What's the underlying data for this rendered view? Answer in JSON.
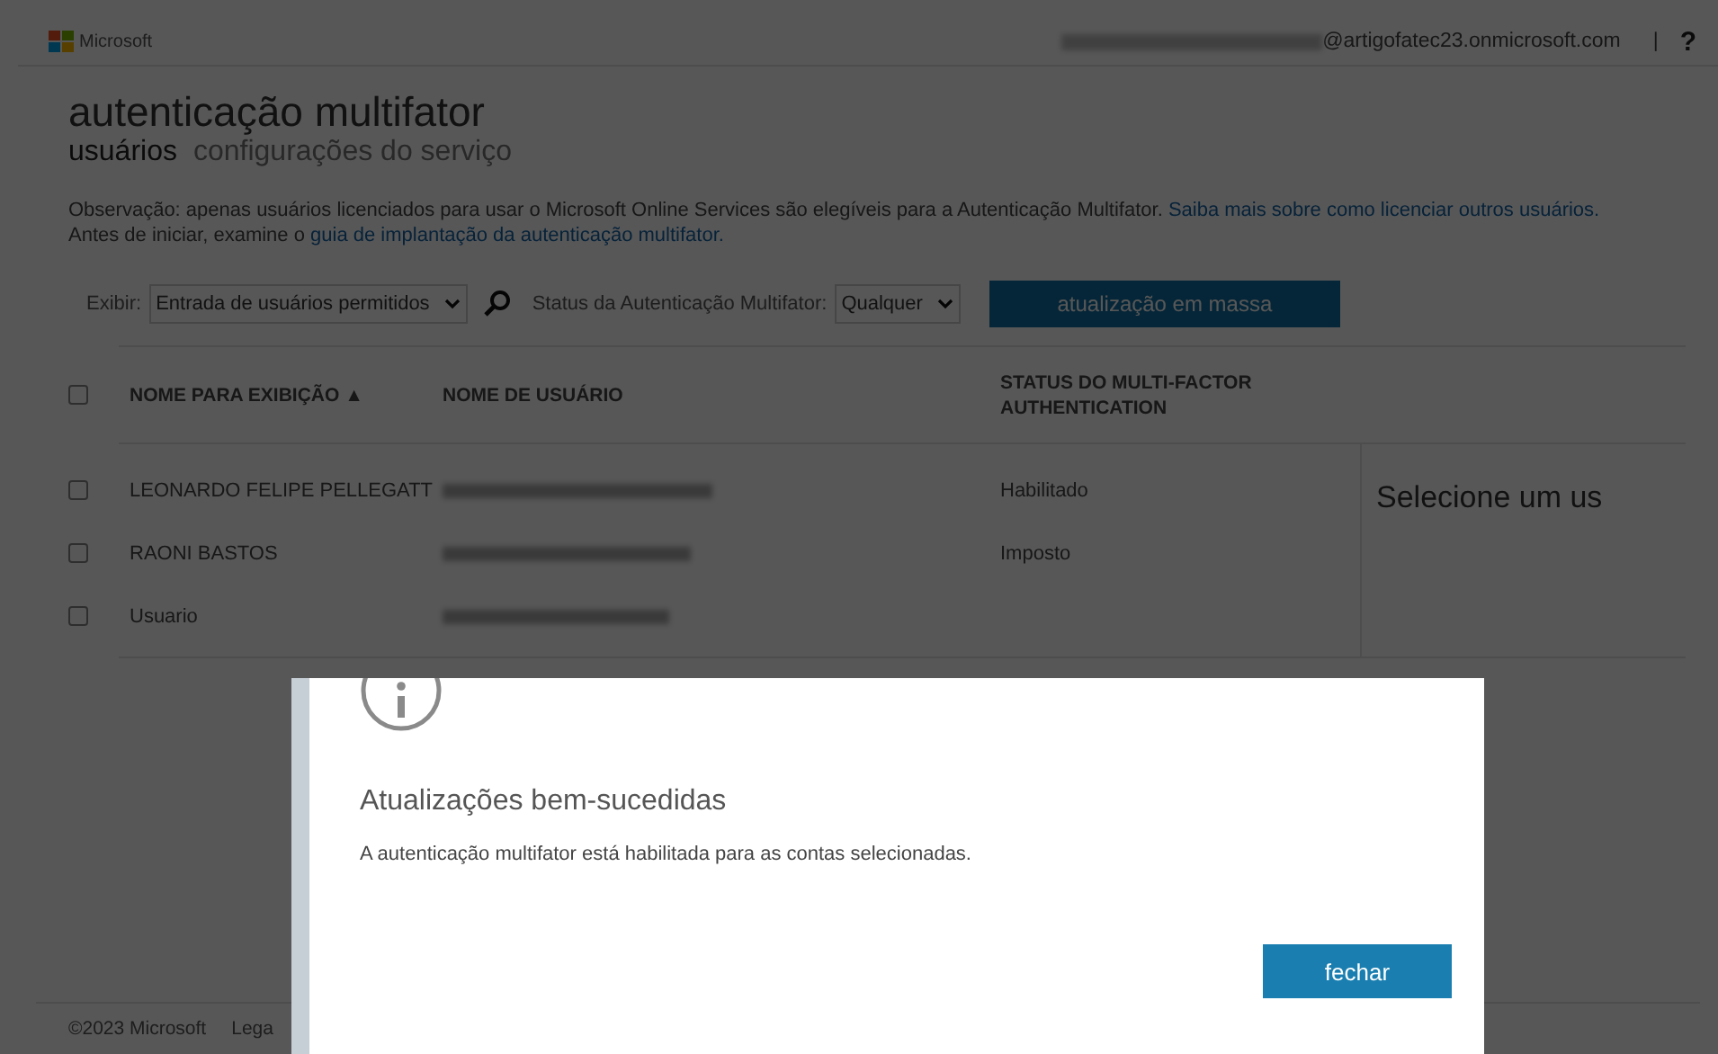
{
  "header": {
    "brand": "Microsoft",
    "account_domain": "@artigofatec23.onmicrosoft.com",
    "separator": "|",
    "help": "?"
  },
  "title": "autenticação multifator",
  "tabs": [
    {
      "label": "usuários",
      "selected": true
    },
    {
      "label": "configurações do serviço",
      "selected": false
    }
  ],
  "note": {
    "text": "Observação: apenas usuários licenciados para usar o Microsoft Online Services são elegíveis para a Autenticação Multifator.",
    "link": "Saiba mais sobre como licenciar outros usuários.",
    "line2": "Antes de iniciar, examine o",
    "link2": "guia de implantação da autenticação multifator."
  },
  "filters": {
    "view_label": "Exibir:",
    "view_value": "Entrada de usuários permitidos",
    "status_label": "Status da Autenticação Multifator:",
    "status_value": "Qualquer",
    "bulk_button": "atualização em massa"
  },
  "table": {
    "all_checked": false,
    "columns": [
      "NOME PARA EXIBIÇÃO ▲",
      "NOME DE USUÁRIO",
      "STATUS DO MULTI-FACTOR AUTHENTICATION"
    ],
    "rows": [
      {
        "name": "LEONARDO FELIPE PELLEGATT",
        "status": "Habilitado",
        "checked": false
      },
      {
        "name": "RAONI BASTOS",
        "status": "Imposto",
        "checked": false
      },
      {
        "name": "Usuario",
        "checked": false
      }
    ]
  },
  "side_panel": {
    "text": "Selecione um us"
  },
  "footer": {
    "copyright": "©2023 Microsoft",
    "link": "Lega"
  },
  "dialog": {
    "title": "Atualizações bem-sucedidas",
    "message": "A autenticação multifator está habilitada para as contas selecionadas.",
    "button": "fechar"
  }
}
